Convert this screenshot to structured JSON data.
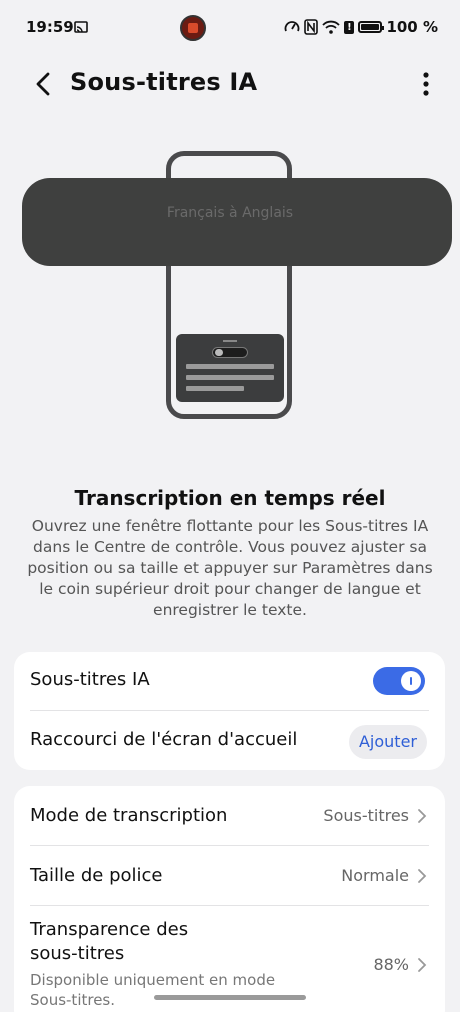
{
  "status_bar": {
    "time": "19:59",
    "battery": "100 %"
  },
  "header": {
    "title": "Sous-titres IA"
  },
  "illustration": {
    "floating_text": "Français à Anglais"
  },
  "description": {
    "title": "Transcription en temps réel",
    "body": "Ouvrez une fenêtre flottante pour les Sous-titres IA dans le Centre de contrôle. Vous pouvez ajuster sa position ou sa taille et appuyer sur Paramètres dans le coin supérieur droit pour changer de langue et enregistrer le texte."
  },
  "card1": {
    "toggle_label": "Sous-titres IA",
    "toggle_on": true,
    "shortcut_label": "Raccourci de l'écran d'accueil",
    "shortcut_button": "Ajouter"
  },
  "card2": {
    "mode_label": "Mode de transcription",
    "mode_value": "Sous-titres",
    "font_label": "Taille de police",
    "font_value": "Normale",
    "transparency_label_line1": "Transparence des",
    "transparency_label_line2": "sous-titres",
    "transparency_value": "88%",
    "transparency_note_line1": "Disponible uniquement en mode",
    "transparency_note_line2": "Sous-titres."
  },
  "colors": {
    "accent": "#3b6be6",
    "background": "#f2f2f4",
    "card": "#ffffff"
  }
}
